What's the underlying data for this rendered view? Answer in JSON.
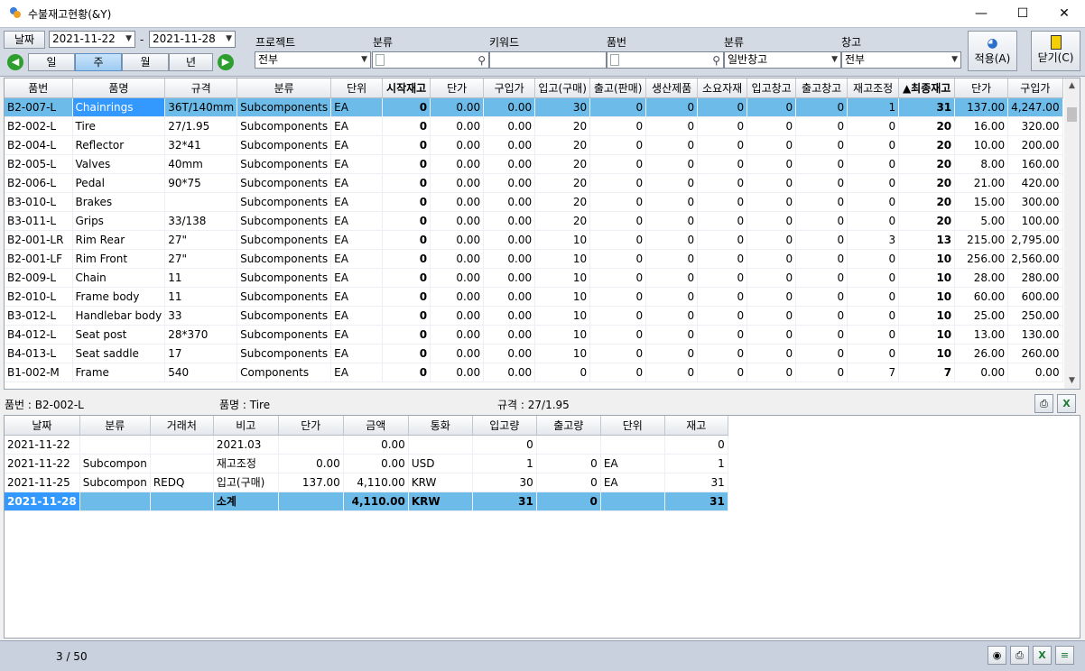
{
  "window": {
    "title": "수불재고현황(&Y)"
  },
  "filters": {
    "date_label": "날짜",
    "date_from": "2021-11-22",
    "date_sep": "-",
    "date_to": "2021-11-28",
    "period_buttons": [
      "일",
      "주",
      "월",
      "년"
    ],
    "project_label": "프로젝트",
    "project_value": "전부",
    "category_label": "분류",
    "keyword_label": "키워드",
    "item_label": "품번",
    "category2_label": "분류",
    "category2_value": "일반창고",
    "warehouse_label": "창고",
    "warehouse_value": "전부",
    "apply_label": "적용(A)",
    "close_label": "닫기(C)"
  },
  "colors": {
    "header_bg": "#d3dae4",
    "selection": "#6cbbe9",
    "selection_key": "#3399ff"
  },
  "main_table": {
    "columns": [
      "품번",
      "품명",
      "규격",
      "분류",
      "단위",
      "시작재고",
      "단가",
      "구입가",
      "입고(구매)",
      "출고(판매)",
      "생산제품",
      "소요자재",
      "입고창고",
      "출고창고",
      "재고조정",
      "▲최종재고",
      "단가",
      "구입가"
    ],
    "rows": [
      [
        "B2-007-L",
        "Chainrings",
        "36T/140mm",
        "Subcomponents",
        "EA",
        "0",
        "0.00",
        "0.00",
        "30",
        "0",
        "0",
        "0",
        "0",
        "0",
        "1",
        "31",
        "137.00",
        "4,247.00"
      ],
      [
        "B2-002-L",
        "Tire",
        "27/1.95",
        "Subcomponents",
        "EA",
        "0",
        "0.00",
        "0.00",
        "20",
        "0",
        "0",
        "0",
        "0",
        "0",
        "0",
        "20",
        "16.00",
        "320.00"
      ],
      [
        "B2-004-L",
        "Reflector",
        "32*41",
        "Subcomponents",
        "EA",
        "0",
        "0.00",
        "0.00",
        "20",
        "0",
        "0",
        "0",
        "0",
        "0",
        "0",
        "20",
        "10.00",
        "200.00"
      ],
      [
        "B2-005-L",
        "Valves",
        "40mm",
        "Subcomponents",
        "EA",
        "0",
        "0.00",
        "0.00",
        "20",
        "0",
        "0",
        "0",
        "0",
        "0",
        "0",
        "20",
        "8.00",
        "160.00"
      ],
      [
        "B2-006-L",
        "Pedal",
        "90*75",
        "Subcomponents",
        "EA",
        "0",
        "0.00",
        "0.00",
        "20",
        "0",
        "0",
        "0",
        "0",
        "0",
        "0",
        "20",
        "21.00",
        "420.00"
      ],
      [
        "B3-010-L",
        "Brakes",
        "",
        "Subcomponents",
        "EA",
        "0",
        "0.00",
        "0.00",
        "20",
        "0",
        "0",
        "0",
        "0",
        "0",
        "0",
        "20",
        "15.00",
        "300.00"
      ],
      [
        "B3-011-L",
        "Grips",
        "33/138",
        "Subcomponents",
        "EA",
        "0",
        "0.00",
        "0.00",
        "20",
        "0",
        "0",
        "0",
        "0",
        "0",
        "0",
        "20",
        "5.00",
        "100.00"
      ],
      [
        "B2-001-LR",
        "Rim Rear",
        "27\"",
        "Subcomponents",
        "EA",
        "0",
        "0.00",
        "0.00",
        "10",
        "0",
        "0",
        "0",
        "0",
        "0",
        "3",
        "13",
        "215.00",
        "2,795.00"
      ],
      [
        "B2-001-LF",
        "Rim Front",
        "27\"",
        "Subcomponents",
        "EA",
        "0",
        "0.00",
        "0.00",
        "10",
        "0",
        "0",
        "0",
        "0",
        "0",
        "0",
        "10",
        "256.00",
        "2,560.00"
      ],
      [
        "B2-009-L",
        "Chain",
        "11",
        "Subcomponents",
        "EA",
        "0",
        "0.00",
        "0.00",
        "10",
        "0",
        "0",
        "0",
        "0",
        "0",
        "0",
        "10",
        "28.00",
        "280.00"
      ],
      [
        "B2-010-L",
        "Frame body",
        "11",
        "Subcomponents",
        "EA",
        "0",
        "0.00",
        "0.00",
        "10",
        "0",
        "0",
        "0",
        "0",
        "0",
        "0",
        "10",
        "60.00",
        "600.00"
      ],
      [
        "B3-012-L",
        "Handlebar body",
        "33",
        "Subcomponents",
        "EA",
        "0",
        "0.00",
        "0.00",
        "10",
        "0",
        "0",
        "0",
        "0",
        "0",
        "0",
        "10",
        "25.00",
        "250.00"
      ],
      [
        "B4-012-L",
        "Seat post",
        "28*370",
        "Subcomponents",
        "EA",
        "0",
        "0.00",
        "0.00",
        "10",
        "0",
        "0",
        "0",
        "0",
        "0",
        "0",
        "10",
        "13.00",
        "130.00"
      ],
      [
        "B4-013-L",
        "Seat saddle",
        "17",
        "Subcomponents",
        "EA",
        "0",
        "0.00",
        "0.00",
        "10",
        "0",
        "0",
        "0",
        "0",
        "0",
        "0",
        "10",
        "26.00",
        "260.00"
      ],
      [
        "B1-002-M",
        "Frame",
        "540",
        "Components",
        "EA",
        "0",
        "0.00",
        "0.00",
        "0",
        "0",
        "0",
        "0",
        "0",
        "0",
        "7",
        "7",
        "0.00",
        "0.00"
      ]
    ]
  },
  "detail": {
    "item_no": "품번 : B2-002-L",
    "item_name": "품명 : Tire",
    "spec": "규격 : 27/1.95",
    "columns": [
      "날짜",
      "분류",
      "거래처",
      "비고",
      "단가",
      "금액",
      "통화",
      "입고량",
      "출고량",
      "단위",
      "재고"
    ],
    "rows": [
      [
        "2021-11-22",
        "",
        "",
        "2021.03",
        "",
        "0.00",
        "",
        "0",
        "",
        "",
        "0"
      ],
      [
        "2021-11-22",
        "Subcompon",
        "",
        "재고조정",
        "0.00",
        "0.00",
        "USD",
        "1",
        "0",
        "EA",
        "1"
      ],
      [
        "2021-11-25",
        "Subcompon",
        "REDQ",
        "입고(구매)",
        "137.00",
        "4,110.00",
        "KRW",
        "30",
        "0",
        "EA",
        "31"
      ],
      [
        "2021-11-28",
        "",
        "",
        "소계",
        "",
        "4,110.00",
        "KRW",
        "31",
        "0",
        "",
        "31"
      ]
    ]
  },
  "status": {
    "record_count": "3 / 50"
  }
}
